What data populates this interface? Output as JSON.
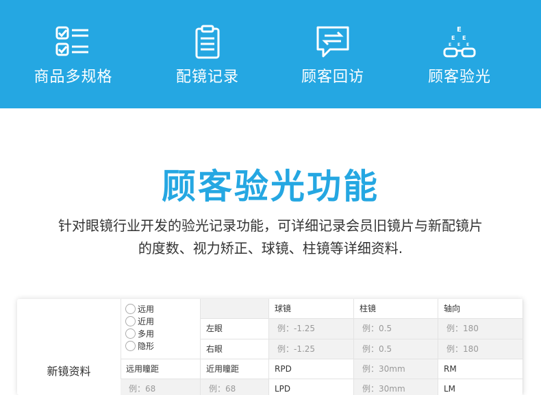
{
  "banner": {
    "features": [
      {
        "label": "商品多规格",
        "icon": "checklist-icon"
      },
      {
        "label": "配镜记录",
        "icon": "clipboard-icon"
      },
      {
        "label": "顾客回访",
        "icon": "chat-exchange-icon"
      },
      {
        "label": "顾客验光",
        "icon": "eye-chart-glasses-icon"
      }
    ]
  },
  "section": {
    "title": "顾客验光功能",
    "description_line1": "针对眼镜行业开发的验光记录功能，可详细记录会员旧镜片与新配镜片",
    "description_line2": "的度数、视力矫正、球镜、柱镜等详细资料."
  },
  "form": {
    "title": "新镜资料",
    "radio_options": [
      "远用",
      "近用",
      "多用",
      "隐形"
    ],
    "headers": {
      "sphere": "球镜",
      "cylinder": "柱镜",
      "axis": "轴向"
    },
    "rows": {
      "left_eye": "左眼",
      "right_eye": "右眼",
      "left_sphere_ph": "例：-1.25",
      "left_cyl_ph": "例：0.5",
      "left_axis_ph": "例：180",
      "right_sphere_ph": "例：-1.25",
      "right_cyl_ph": "例：0.5",
      "right_axis_ph": "例：180"
    },
    "pd": {
      "far_label": "远用瞳距",
      "near_label": "近用瞳距",
      "rpd_label": "RPD",
      "rpd_ph": "例：30mm",
      "rm_label": "RM",
      "far_ph": "例：68",
      "near_ph": "例：68",
      "lpd_label": "LPD",
      "lpd_ph": "例：30mm",
      "lm_label": "LM"
    }
  },
  "colors": {
    "brand_blue": "#25a7e2",
    "text": "#333333",
    "placeholder": "#999999"
  }
}
